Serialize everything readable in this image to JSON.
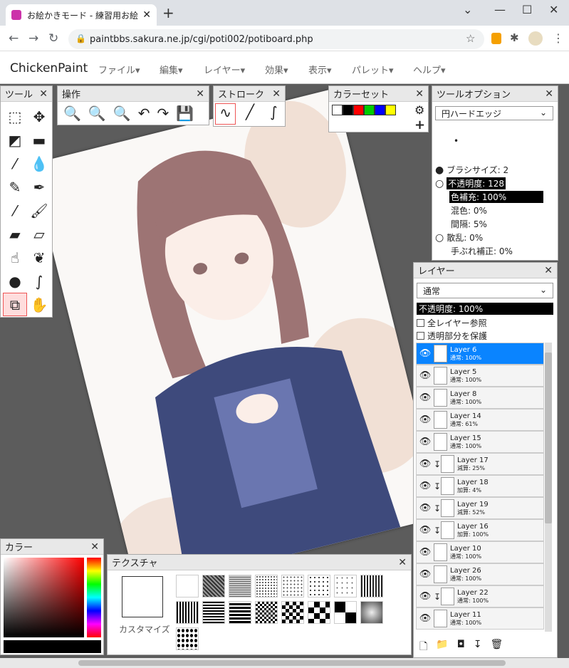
{
  "browser": {
    "tab_title": "お絵かきモード - 練習用お絵かき掲示",
    "url": "paintbbs.sakura.ne.jp/cgi/poti002/potiboard.php"
  },
  "app": {
    "brand": "ChickenPaint",
    "menus": [
      "ファイル▾",
      "編集▾",
      "レイヤー▾",
      "効果▾",
      "表示▾",
      "パレット▾",
      "ヘルプ▾"
    ]
  },
  "panels": {
    "tools": {
      "title": "ツール"
    },
    "ops": {
      "title": "操作"
    },
    "stroke": {
      "title": "ストローク"
    },
    "colorset": {
      "title": "カラーセット",
      "colors": [
        "#ffffff",
        "#000000",
        "#ff0000",
        "#00cc00",
        "#0000ff",
        "#ffff00"
      ]
    },
    "tooloptions": {
      "title": "ツールオプション",
      "brush": "円ハードエッジ",
      "brush_size": "ブラシサイズ: 2",
      "opacity": "不透明度: 128",
      "color_fill": "色補充: 100%",
      "mix": "混色: 0%",
      "spacing": "間隔: 5%",
      "scatter": "散乱: 0%",
      "stabilizer": "手ぶれ補正: 0%"
    },
    "layers": {
      "title": "レイヤー",
      "blend": "通常",
      "opacity": "不透明度: 100%",
      "check_all": "全レイヤー参照",
      "check_protect": "透明部分を保護",
      "items": [
        {
          "name": "Layer 6",
          "mode": "通常: 100%"
        },
        {
          "name": "Layer 5",
          "mode": "通常: 100%"
        },
        {
          "name": "Layer 8",
          "mode": "通常: 100%"
        },
        {
          "name": "Layer 14",
          "mode": "通常: 61%"
        },
        {
          "name": "Layer 15",
          "mode": "通常: 100%"
        },
        {
          "name": "Layer 17",
          "mode": "減算: 25%"
        },
        {
          "name": "Layer 18",
          "mode": "加算: 4%"
        },
        {
          "name": "Layer 19",
          "mode": "減算: 52%"
        },
        {
          "name": "Layer 16",
          "mode": "加算: 100%"
        },
        {
          "name": "Layer 10",
          "mode": "通常: 100%"
        },
        {
          "name": "Layer 26",
          "mode": "通常: 100%"
        },
        {
          "name": "Layer 22",
          "mode": "通常: 100%"
        },
        {
          "name": "Layer 11",
          "mode": "通常: 100%"
        }
      ]
    },
    "color": {
      "title": "カラー"
    },
    "texture": {
      "title": "テクスチャ",
      "customize": "カスタマイズ"
    }
  },
  "colors": {
    "accent": "#0a84ff",
    "selection": "#e55555"
  }
}
